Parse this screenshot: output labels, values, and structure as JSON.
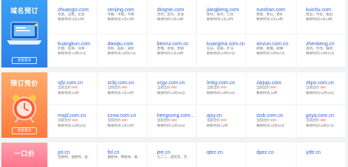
{
  "sections": {
    "domain": {
      "title": "域名预订",
      "button": "查看更多",
      "items": [
        {
          "name": "zhuangci.com",
          "desc": "装瓷，庄慈，壮瓷",
          "time_label": "剩余时间:",
          "time": "2天13时"
        },
        {
          "name": "cenjing.com",
          "desc": "岑静，岑镜，岑菁",
          "time_label": "剩余时间:",
          "time": "2天13时"
        },
        {
          "name": "dingnei.com",
          "desc": "顶内，定内，定讷",
          "time_label": "剩余时间:",
          "time": "2天13时"
        },
        {
          "name": "jiangkeng.com",
          "desc": "蒋坑，姜坑，江坑",
          "time_label": "剩余时间:",
          "time": "2天13时"
        },
        {
          "name": "ruoshan.com",
          "desc": "若善，若山，若杉",
          "time_label": "剩余时间:",
          "time": "2天13时"
        },
        {
          "name": "kuichu.com",
          "desc": "馈出，亏初，魁出",
          "time_label": "剩余时间:",
          "time": "2天13时"
        },
        {
          "name": "kuangkun.com",
          "desc": "旷鲲，狂坤，况坤",
          "time_label": "剩余时间:",
          "time": "12时47分"
        },
        {
          "name": "daoqiu.com",
          "desc": "到秋，稻秋，道秋",
          "time_label": "剩余时间:",
          "time": "12时47分"
        },
        {
          "name": "benrui.com.cn",
          "desc": "奔瑞，本锐，奔锐",
          "time_label": "剩余时间:",
          "time": "1天16时"
        },
        {
          "name": "kuangma.com.cn",
          "desc": "狂马，狂嘛，旷马",
          "time_label": "剩余时间:",
          "time": "12时47分"
        },
        {
          "name": "xinzun.com.cn",
          "desc": "新尊，新遵，新樽",
          "time_label": "剩余时间:",
          "time": "12时47分"
        },
        {
          "name": "zhenkeng.cn",
          "desc": "真坑，珍坑，振坑",
          "time_label": "剩余时间:",
          "time": "12时47分"
        }
      ]
    },
    "bid": {
      "title": "预订竞价",
      "button": "查看更多",
      "items": [
        {
          "name": "sjfz.com.cn",
          "price_label": "当前出价:",
          "price": "¥80",
          "time_label": "剩余时间:",
          "time": "11时"
        },
        {
          "name": "scbj.com.cn",
          "price_label": "当前出价:",
          "price": "¥80",
          "time_label": "剩余时间:",
          "time": "1天11时"
        },
        {
          "name": "xcgz.com.cn",
          "price_label": "当前出价:",
          "price": "¥80",
          "time_label": "剩余时间:",
          "time": "11时32分"
        },
        {
          "name": "lmkg.com.cn",
          "price_label": "当前出价:",
          "price": "¥80",
          "time_label": "剩余时间:",
          "time": "10时32分"
        },
        {
          "name": "zaijuju.com",
          "price_label": "当前出价:",
          "price": "¥80",
          "time_label": "剩余时间:",
          "time": "11时"
        },
        {
          "name": "zkpx.com.cn",
          "price_label": "当前出价:",
          "price": "¥80",
          "time_label": "剩余时间:",
          "time": "11时32分"
        },
        {
          "name": "mxjd.com.cn",
          "price_label": "当前出价:",
          "price": "¥80",
          "time_label": "剩余时间:",
          "time": "11时32分"
        },
        {
          "name": "cznw.com.cn",
          "price_label": "当前出价:",
          "price": "¥80",
          "time_label": "剩余时间:",
          "time": "1天11时"
        },
        {
          "name": "hengnong.com...",
          "price_label": "当前出价:",
          "price": "¥80",
          "time_label": "剩余时间:",
          "time": "11时32分"
        },
        {
          "name": "ajsy.cn",
          "price_label": "当前出价:",
          "price": "¥80",
          "time_label": "剩余时间:",
          "time": "11时"
        },
        {
          "name": "tzsb.com.cn",
          "price_label": "当前出价:",
          "price": "¥80",
          "time_label": "剩余时间:",
          "time": "11时32分"
        },
        {
          "name": "gsyq.com.cn",
          "price_label": "当前出价:",
          "price": "¥80",
          "time_label": "剩余时间:",
          "time": "11时47分"
        }
      ]
    },
    "fixed": {
      "title": "一口价",
      "items": [
        {
          "name": "jot.cn",
          "desc": "吉欧特，金欧特，金..."
        },
        {
          "name": "fol.cn",
          "desc": "富欧林，菲欧林，富..."
        },
        {
          "name": "jee.cn",
          "desc": "九二二，结贰贰，吉..."
        },
        {
          "name": "qtez.cn",
          "desc": ""
        },
        {
          "name": "dpez.cn",
          "desc": ""
        },
        {
          "name": "ydtr.cn",
          "desc": ""
        }
      ]
    }
  },
  "colors": {
    "link": "#2a63d6",
    "price": "#ff5a1f",
    "domain_banner": "#2b7fe8",
    "bid_banner": "#ff7a3c",
    "fixed_banner": "#ff7087"
  }
}
